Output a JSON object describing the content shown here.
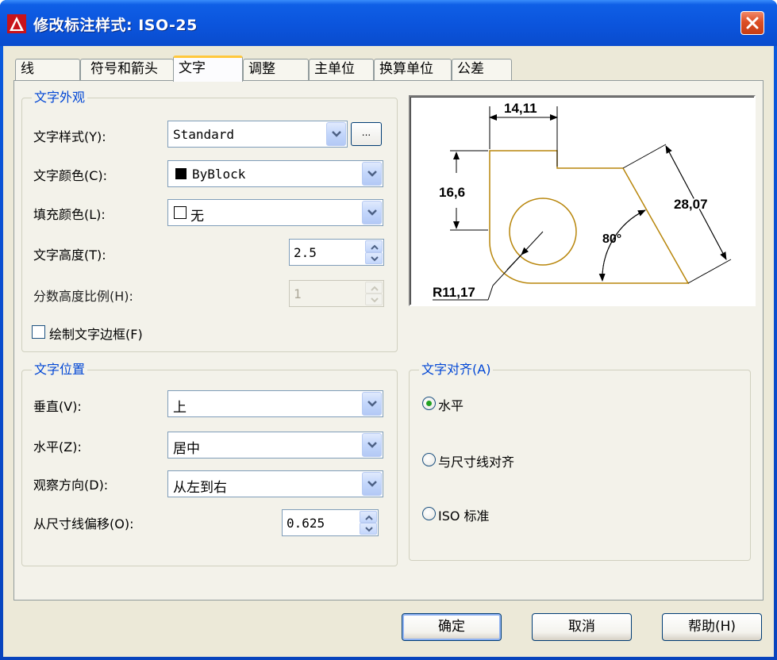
{
  "window": {
    "title": "修改标注样式: ISO-25"
  },
  "tabs": [
    {
      "label": "线"
    },
    {
      "label": "符号和箭头"
    },
    {
      "label": "文字"
    },
    {
      "label": "调整"
    },
    {
      "label": "主单位"
    },
    {
      "label": "换算单位"
    },
    {
      "label": "公差"
    }
  ],
  "active_tab": "文字",
  "text_appearance": {
    "title": "文字外观",
    "text_style_label": "文字样式(Y):",
    "text_style_value": "Standard",
    "browse_label": "...",
    "text_color_label": "文字颜色(C):",
    "text_color_value": "ByBlock",
    "fill_color_label": "填充颜色(L):",
    "fill_color_value": "无",
    "text_height_label": "文字高度(T):",
    "text_height_value": "2.5",
    "fraction_scale_label": "分数高度比例(H):",
    "fraction_scale_value": "1",
    "draw_frame_label": "绘制文字边框(F)",
    "draw_frame_checked": false
  },
  "text_placement": {
    "title": "文字位置",
    "vertical_label": "垂直(V):",
    "vertical_value": "上",
    "horizontal_label": "水平(Z):",
    "horizontal_value": "居中",
    "view_direction_label": "观察方向(D):",
    "view_direction_value": "从左到右",
    "offset_label": "从尺寸线偏移(O):",
    "offset_value": "0.625"
  },
  "text_alignment": {
    "title": "文字对齐(A)",
    "options": [
      {
        "label": "水平",
        "selected": true
      },
      {
        "label": "与尺寸线对齐",
        "selected": false
      },
      {
        "label": "ISO 标准",
        "selected": false
      }
    ]
  },
  "preview": {
    "dim_top": "14,11",
    "dim_left": "16,6",
    "dim_right": "28,07",
    "dim_angle": "80°",
    "dim_radius": "R11,17",
    "part_color": "#b8860b"
  },
  "buttons": {
    "ok": "确定",
    "cancel": "取消",
    "help": "帮助(H)"
  }
}
